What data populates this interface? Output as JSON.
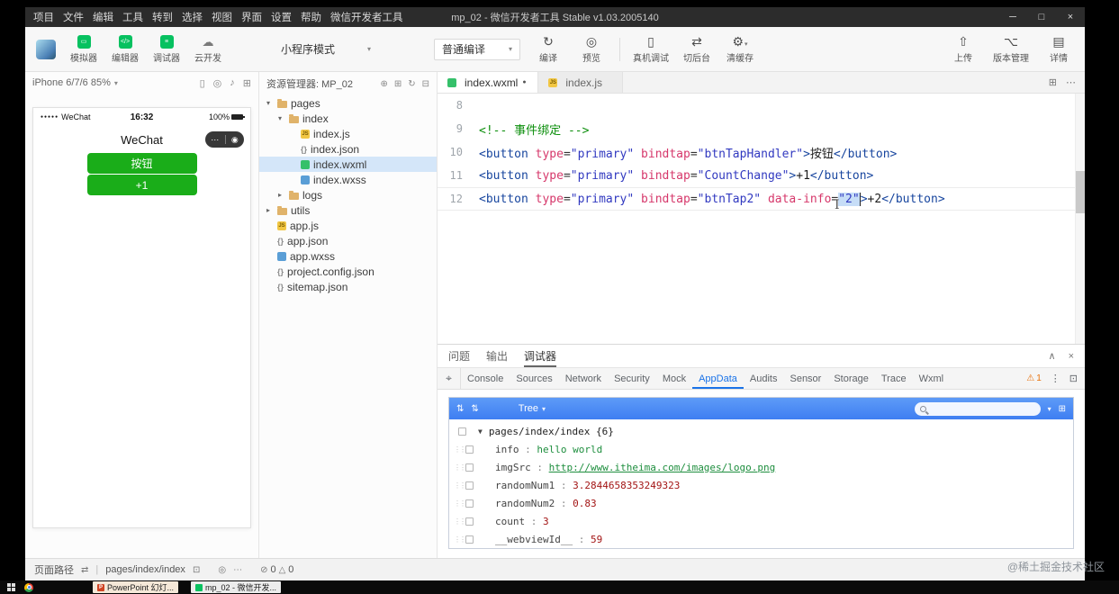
{
  "window": {
    "title": "mp_02 - 微信开发者工具 Stable v1.03.2005140"
  },
  "menubar": {
    "items": [
      "项目",
      "文件",
      "编辑",
      "工具",
      "转到",
      "选择",
      "视图",
      "界面",
      "设置",
      "帮助",
      "微信开发者工具"
    ]
  },
  "toolbar": {
    "panels": [
      {
        "label": "模拟器",
        "icon": "simulator-icon",
        "style": "green"
      },
      {
        "label": "编辑器",
        "icon": "editor-icon",
        "style": "green"
      },
      {
        "label": "调试器",
        "icon": "debugger-icon",
        "style": "green"
      },
      {
        "label": "云开发",
        "icon": "cloud-icon",
        "style": "plain"
      }
    ],
    "mode_select": {
      "value": "小程序模式"
    },
    "compile_select": {
      "value": "普通编译"
    },
    "actions": [
      {
        "label": "编译",
        "icon": "compile-icon"
      },
      {
        "label": "预览",
        "icon": "preview-icon"
      },
      {
        "label": "真机调试",
        "icon": "phone-debug-icon",
        "sep_before": true
      },
      {
        "label": "切后台",
        "icon": "background-switch-icon"
      },
      {
        "label": "清缓存",
        "icon": "clear-cache-icon",
        "caret": true
      }
    ],
    "right_actions": [
      {
        "label": "上传",
        "icon": "upload-icon"
      },
      {
        "label": "版本管理",
        "icon": "version-control-icon"
      },
      {
        "label": "详情",
        "icon": "details-icon"
      }
    ]
  },
  "simulator": {
    "device_label": "iPhone 6/7/6 85%",
    "status": {
      "carrier": "WeChat",
      "time": "16:32",
      "battery": "100%"
    },
    "nav_title": "WeChat",
    "buttons": [
      {
        "label": "按钮"
      },
      {
        "label": "+1"
      }
    ],
    "button_color": "#1aad19"
  },
  "explorer": {
    "title": "资源管理器: MP_02",
    "items": [
      {
        "label": "pages",
        "type": "folder",
        "depth": 0,
        "expanded": true
      },
      {
        "label": "index",
        "type": "folder",
        "depth": 1,
        "expanded": true
      },
      {
        "label": "index.js",
        "type": "js",
        "depth": 2
      },
      {
        "label": "index.json",
        "type": "json",
        "depth": 2
      },
      {
        "label": "index.wxml",
        "type": "wxml",
        "depth": 2,
        "selected": true
      },
      {
        "label": "index.wxss",
        "type": "wxss",
        "depth": 2
      },
      {
        "label": "logs",
        "type": "folder",
        "depth": 1,
        "expanded": false
      },
      {
        "label": "utils",
        "type": "folder",
        "depth": 0,
        "expanded": false
      },
      {
        "label": "app.js",
        "type": "js",
        "depth": 0
      },
      {
        "label": "app.json",
        "type": "json",
        "depth": 0
      },
      {
        "label": "app.wxss",
        "type": "wxss",
        "depth": 0
      },
      {
        "label": "project.config.json",
        "type": "json",
        "depth": 0
      },
      {
        "label": "sitemap.json",
        "type": "json",
        "depth": 0
      }
    ]
  },
  "editor": {
    "tabs": [
      {
        "label": "index.wxml",
        "icon": "wxml",
        "modified": true,
        "active": true
      },
      {
        "label": "index.js",
        "icon": "js",
        "modified": false,
        "active": false
      }
    ],
    "lines": [
      {
        "num": "8",
        "tokens": []
      },
      {
        "num": "9",
        "tokens": [
          {
            "t": "comment",
            "s": "<!-- 事件绑定 -->"
          }
        ]
      },
      {
        "num": "10",
        "tokens": [
          {
            "t": "tag",
            "s": "<button"
          },
          {
            "t": "attr",
            "s": " type"
          },
          {
            "t": "op",
            "s": "="
          },
          {
            "t": "str",
            "s": "\"primary\""
          },
          {
            "t": "attr",
            "s": " bindtap"
          },
          {
            "t": "op",
            "s": "="
          },
          {
            "t": "str",
            "s": "\"btnTapHandler\""
          },
          {
            "t": "tag",
            "s": ">"
          },
          {
            "t": "txt",
            "s": "按钮"
          },
          {
            "t": "tag",
            "s": "</button>"
          }
        ]
      },
      {
        "num": "11",
        "tokens": [
          {
            "t": "tag",
            "s": "<button"
          },
          {
            "t": "attr",
            "s": " type"
          },
          {
            "t": "op",
            "s": "="
          },
          {
            "t": "str",
            "s": "\"primary\""
          },
          {
            "t": "attr",
            "s": " bindtap"
          },
          {
            "t": "op",
            "s": "="
          },
          {
            "t": "str",
            "s": "\"CountChange\""
          },
          {
            "t": "tag",
            "s": ">"
          },
          {
            "t": "txt",
            "s": "+1"
          },
          {
            "t": "tag",
            "s": "</button>"
          }
        ]
      },
      {
        "num": "12",
        "current": true,
        "tokens": [
          {
            "t": "tag",
            "s": "<button"
          },
          {
            "t": "attr",
            "s": " type"
          },
          {
            "t": "op",
            "s": "="
          },
          {
            "t": "str",
            "s": "\"primary\""
          },
          {
            "t": "attr",
            "s": " bindtap"
          },
          {
            "t": "op",
            "s": "="
          },
          {
            "t": "str",
            "s": "\"btnTap2\""
          },
          {
            "t": "attr",
            "s": " data-info"
          },
          {
            "t": "op",
            "s": "="
          },
          {
            "t": "str",
            "s": "\"2\"",
            "sel": true
          },
          {
            "t": "tag",
            "s": ">"
          },
          {
            "t": "txt",
            "s": "+2"
          },
          {
            "t": "tag",
            "s": "</button>"
          }
        ]
      }
    ]
  },
  "debugger": {
    "panel_tabs": [
      {
        "label": "问题"
      },
      {
        "label": "输出"
      },
      {
        "label": "调试器",
        "active": true
      }
    ],
    "devtools_tabs": [
      "Console",
      "Sources",
      "Network",
      "Security",
      "Mock",
      "AppData",
      "Audits",
      "Sensor",
      "Storage",
      "Trace",
      "Wxml"
    ],
    "active_devtools_tab": "AppData",
    "warning_count": "1",
    "tree_dropdown": "Tree",
    "appdata_root": "pages/index/index {6}",
    "appdata_rows": [
      {
        "key": "info",
        "value": "hello world",
        "type": "string"
      },
      {
        "key": "imgSrc",
        "value": "http://www.itheima.com/images/logo.png",
        "type": "link"
      },
      {
        "key": "randomNum1",
        "value": "3.2844658353249323",
        "type": "number"
      },
      {
        "key": "randomNum2",
        "value": "0.83",
        "type": "number"
      },
      {
        "key": "count",
        "value": "3",
        "type": "number"
      },
      {
        "key": "__webviewId__",
        "value": "59",
        "type": "number"
      }
    ]
  },
  "statusbar": {
    "page_path_label": "页面路径",
    "page_path": "pages/index/index",
    "error_count": "0",
    "warning_count": "0"
  },
  "taskbar": {
    "items": [
      {
        "label": "PowerPoint 幻灯...",
        "icon": "powerpoint-icon"
      },
      {
        "label": "mp_02 - 微信开发...",
        "icon": "devtools-icon"
      }
    ]
  },
  "watermark": "@稀土掘金技术社区",
  "colors": {
    "wechat_green": "#07c160",
    "phone_button_green": "#1aad19",
    "appdata_header_blue": "#4a8bf0",
    "devtools_active_blue": "#1a73e8"
  }
}
